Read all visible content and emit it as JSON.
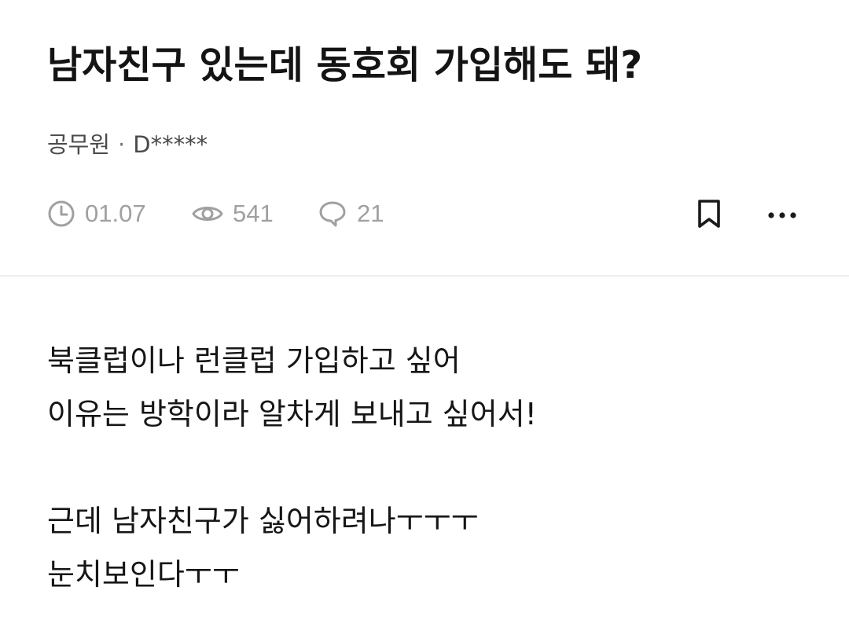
{
  "post": {
    "title": "남자친구 있는데 동호회 가입해도 돼?",
    "author_job": "공무원",
    "author_separator": "·",
    "author_name": "D*****"
  },
  "meta": {
    "date": "01.07",
    "views": "541",
    "comments": "21",
    "icons": {
      "date": "clock-icon",
      "views": "eye-icon",
      "comments": "speech-bubble-icon",
      "bookmark": "bookmark-icon",
      "more": "more-dots-icon"
    }
  },
  "body": {
    "lines": [
      "북클럽이나 런클럽 가입하고 싶어",
      "이유는 방학이라 알차게 보내고 싶어서!",
      "",
      "근데 남자친구가 싫어하려나ㅜㅜㅜ",
      "눈치보인다ㅜㅜ"
    ]
  },
  "colors": {
    "text": "#141414",
    "meta": "#a0a0a0",
    "divider": "#eeeeee"
  }
}
